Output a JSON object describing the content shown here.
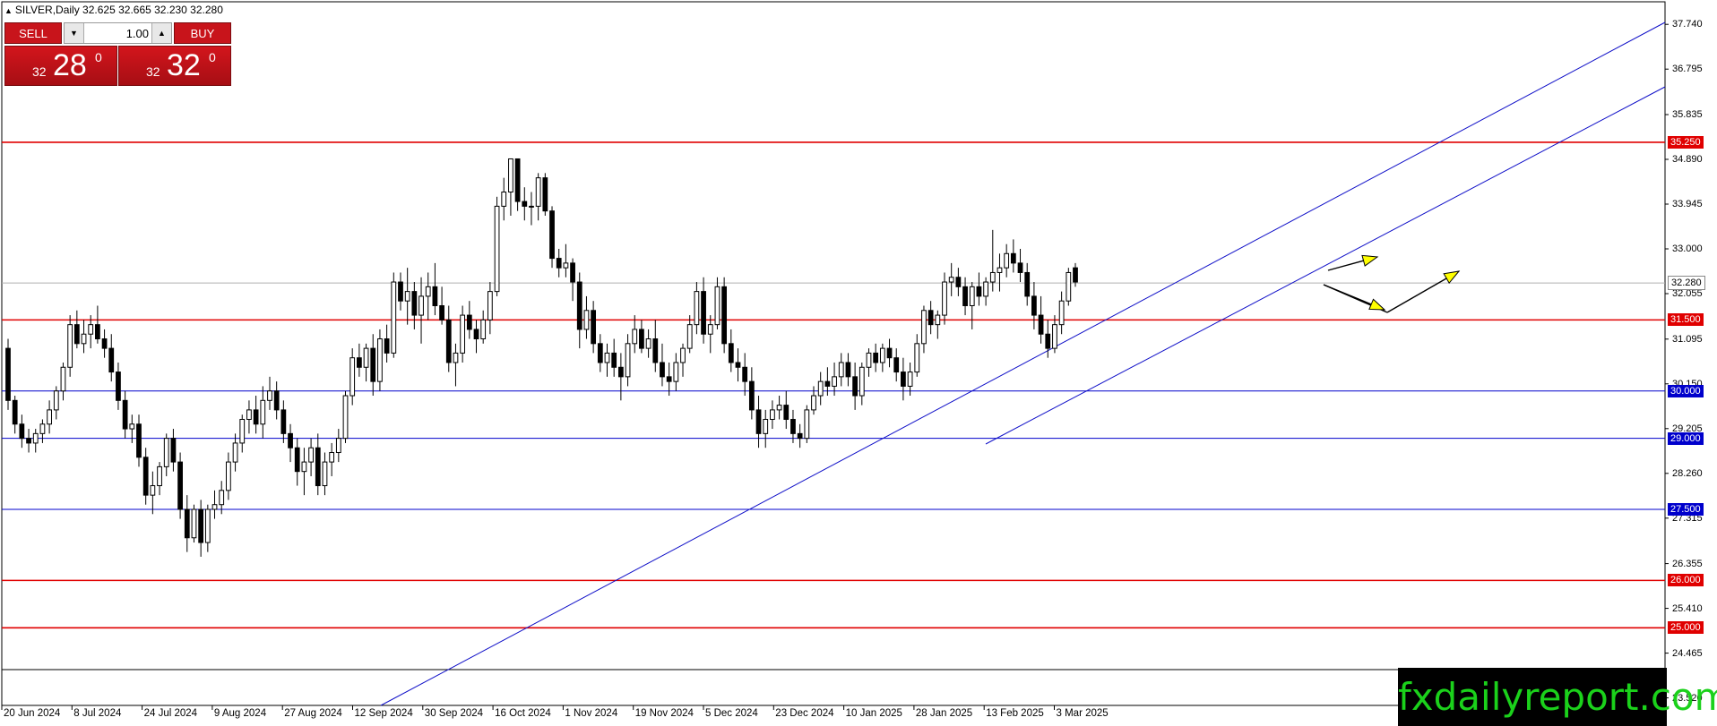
{
  "title": {
    "symbol_line": "SILVER,Daily  32.625 32.665 32.230 32.280"
  },
  "trade_panel": {
    "sell_label": "SELL",
    "buy_label": "BUY",
    "lot_value": "1.00",
    "sell_price": {
      "small": "32",
      "big": "28",
      "sup": "0"
    },
    "buy_price": {
      "small": "32",
      "big": "32",
      "sup": "0"
    }
  },
  "colors": {
    "background": "#ffffff",
    "red_level": "#e00000",
    "blue_level": "#0000cc",
    "candle_up": "#ffffff",
    "candle_down": "#000000",
    "arrow_fill": "#ffff00",
    "watermark_text": "#1bd11b"
  },
  "y_axis": {
    "ticks": [
      "37.740",
      "36.795",
      "35.835",
      "34.890",
      "33.945",
      "33.000",
      "32.055",
      "31.095",
      "30.150",
      "29.205",
      "28.260",
      "27.315",
      "26.355",
      "25.410",
      "24.465",
      "23.520"
    ]
  },
  "levels": [
    {
      "price": 35.25,
      "label": "35.250",
      "color": "red"
    },
    {
      "price": 31.5,
      "label": "31.500",
      "color": "red"
    },
    {
      "price": 30.0,
      "label": "30.000",
      "color": "blue"
    },
    {
      "price": 29.0,
      "label": "29.000",
      "color": "blue"
    },
    {
      "price": 27.5,
      "label": "27.500",
      "color": "blue"
    },
    {
      "price": 26.0,
      "label": "26.000",
      "color": "red"
    },
    {
      "price": 25.0,
      "label": "25.000",
      "color": "red"
    }
  ],
  "current_price": {
    "price": 32.28,
    "label": "32.280"
  },
  "x_axis": {
    "ticks": [
      "20 Jun 2024",
      "8 Jul 2024",
      "24 Jul 2024",
      "9 Aug 2024",
      "27 Aug 2024",
      "12 Sep 2024",
      "30 Sep 2024",
      "16 Oct 2024",
      "1 Nov 2024",
      "19 Nov 2024",
      "5 Dec 2024",
      "23 Dec 2024",
      "10 Jan 2025",
      "28 Jan 2025",
      "13 Feb 2025",
      "3 Mar 2025"
    ]
  },
  "icons": {
    "arrow_up_a": "yellow-arrow-up",
    "arrow_down": "yellow-arrow-down-then-up"
  },
  "watermark": "fxdailyreport.com"
}
